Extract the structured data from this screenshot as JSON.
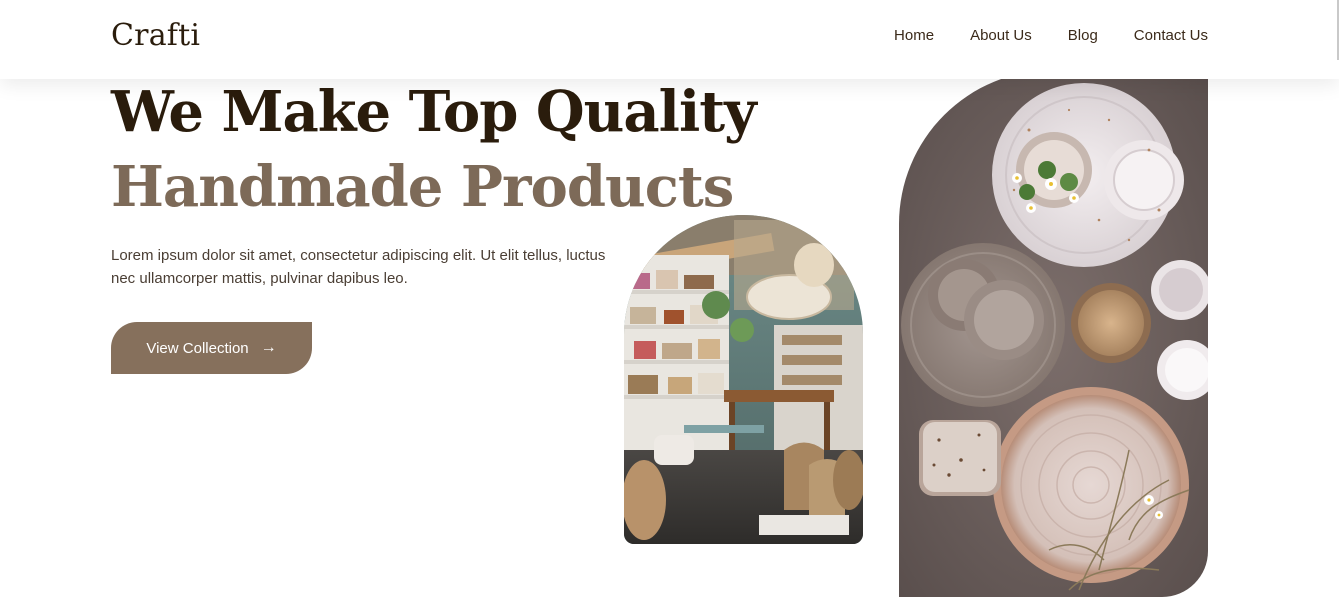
{
  "header": {
    "logo": "Crafti",
    "nav": [
      {
        "label": "Home"
      },
      {
        "label": "About Us"
      },
      {
        "label": "Blog"
      },
      {
        "label": "Contact Us"
      }
    ]
  },
  "hero": {
    "title_line1": "We Make Top Quality",
    "title_line2": "Handmade Products",
    "description": "Lorem ipsum dolor sit amet, consectetur adipiscing elit. Ut elit tellus, luctus nec ullamcorper mattis, pulvinar dapibus leo.",
    "cta_label": "View Collection",
    "cta_icon": "arrow-right-icon"
  },
  "colors": {
    "dark_text": "#2a1c0c",
    "accent_brown": "#86705c",
    "secondary_title": "#7d6a58"
  }
}
